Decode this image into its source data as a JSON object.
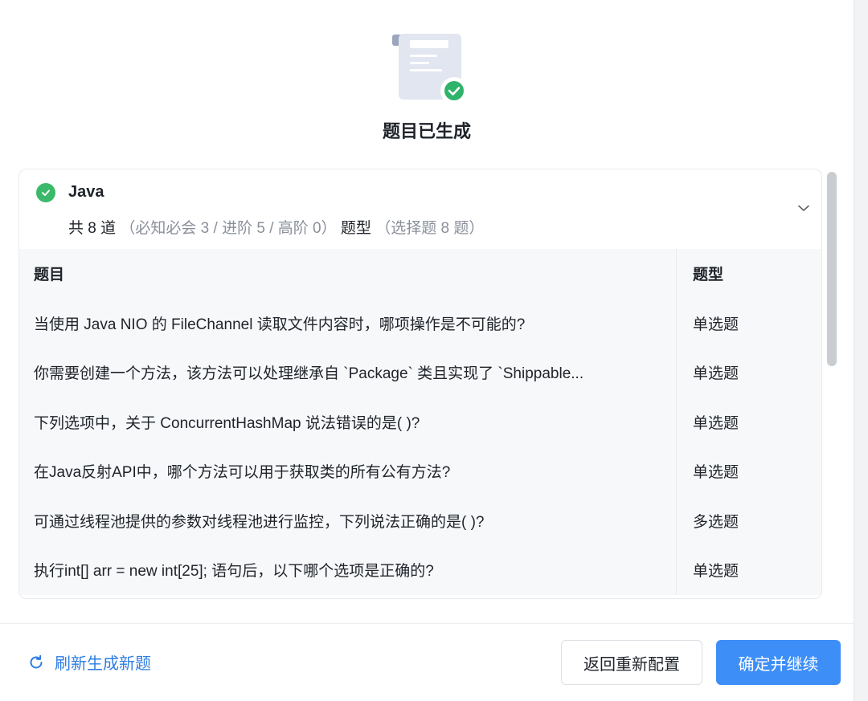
{
  "dialog": {
    "title": "题目已生成"
  },
  "card": {
    "language": "Java",
    "summary_count": "共 8 道",
    "summary_levels": "（必知必会 3 / 进阶 5 / 高阶 0）",
    "summary_type_label": "题型",
    "summary_types": "（选择题 8 题）"
  },
  "table": {
    "header_question": "题目",
    "header_type": "题型",
    "rows": [
      {
        "question": "当使用 Java NIO 的 FileChannel 读取文件内容时，哪项操作是不可能的?",
        "type": "单选题"
      },
      {
        "question": "你需要创建一个方法，该方法可以处理继承自 `Package` 类且实现了 `Shippable...",
        "type": "单选题"
      },
      {
        "question": "下列选项中，关于 ConcurrentHashMap 说法错误的是( )?",
        "type": "单选题"
      },
      {
        "question": "在Java反射API中，哪个方法可以用于获取类的所有公有方法?",
        "type": "单选题"
      },
      {
        "question": "可通过线程池提供的参数对线程池进行监控，下列说法正确的是( )?",
        "type": "多选题"
      },
      {
        "question": "执行int[] arr = new int[25]; 语句后，以下哪个选项是正确的?",
        "type": "单选题"
      }
    ]
  },
  "footer": {
    "refresh_label": "刷新生成新题",
    "back_label": "返回重新配置",
    "confirm_label": "确定并继续"
  },
  "colors": {
    "accent": "#3e8ef7",
    "link": "#2f7de1",
    "success": "#3bb96a"
  },
  "icons": {
    "hero": "document-check-icon",
    "status": "check-circle-icon",
    "expand": "chevron-down-icon",
    "refresh": "refresh-icon"
  }
}
